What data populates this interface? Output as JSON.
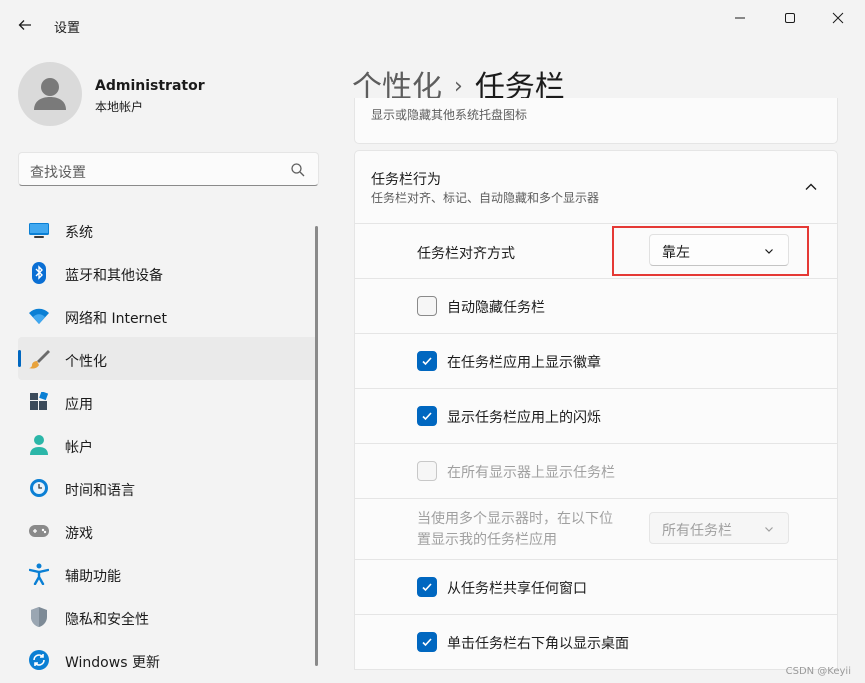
{
  "window": {
    "title": "设置"
  },
  "user": {
    "name": "Administrator",
    "account_type": "本地帐户"
  },
  "search": {
    "placeholder": "查找设置"
  },
  "sidebar": {
    "items": [
      {
        "label": "系统",
        "icon": "system-icon",
        "selected": false
      },
      {
        "label": "蓝牙和其他设备",
        "icon": "bluetooth-icon",
        "selected": false
      },
      {
        "label": "网络和 Internet",
        "icon": "wifi-icon",
        "selected": false
      },
      {
        "label": "个性化",
        "icon": "brush-icon",
        "selected": true
      },
      {
        "label": "应用",
        "icon": "apps-icon",
        "selected": false
      },
      {
        "label": "帐户",
        "icon": "account-icon",
        "selected": false
      },
      {
        "label": "时间和语言",
        "icon": "time-language-icon",
        "selected": false
      },
      {
        "label": "游戏",
        "icon": "gamepad-icon",
        "selected": false
      },
      {
        "label": "辅助功能",
        "icon": "accessibility-icon",
        "selected": false
      },
      {
        "label": "隐私和安全性",
        "icon": "shield-icon",
        "selected": false
      },
      {
        "label": "Windows 更新",
        "icon": "update-icon",
        "selected": false
      }
    ]
  },
  "breadcrumb": {
    "parent": "个性化",
    "separator": "›",
    "current": "任务栏"
  },
  "top_card": {
    "text": "显示或隐藏其他系统托盘图标"
  },
  "behavior_group": {
    "title": "任务栏行为",
    "subtitle": "任务栏对齐、标记、自动隐藏和多个显示器",
    "alignment": {
      "label": "任务栏对齐方式",
      "value": "靠左"
    },
    "options": [
      {
        "label": "自动隐藏任务栏",
        "checked": false,
        "disabled": false
      },
      {
        "label": "在任务栏应用上显示徽章",
        "checked": true,
        "disabled": false
      },
      {
        "label": "显示任务栏应用上的闪烁",
        "checked": true,
        "disabled": false
      },
      {
        "label": "在所有显示器上显示任务栏",
        "checked": false,
        "disabled": true
      }
    ],
    "multi_display": {
      "label_line1": "当使用多个显示器时，在以下位",
      "label_line2": "置显示我的任务栏应用",
      "value": "所有任务栏",
      "disabled": true
    },
    "options_after": [
      {
        "label": "从任务栏共享任何窗口",
        "checked": true
      },
      {
        "label": "单击任务栏右下角以显示桌面",
        "checked": true
      }
    ]
  },
  "watermark": "CSDN @Keyii",
  "colors": {
    "accent": "#0067c0",
    "highlight": "#e53935",
    "background": "#f3f3f3",
    "card": "#fbfbfb"
  }
}
